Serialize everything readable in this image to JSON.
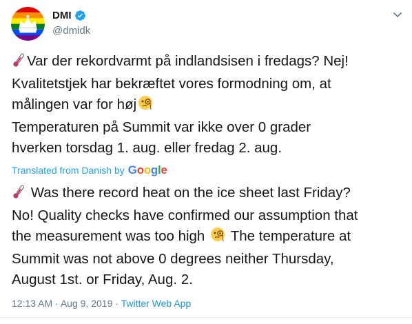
{
  "account": {
    "display_name": "DMI",
    "handle": "@dmidk"
  },
  "icons": {
    "verified": "verified-badge-icon",
    "caret": "chevron-down-icon",
    "thermometer": "thermometer-emoji",
    "monocle": "face-with-monocle-emoji"
  },
  "tweet": {
    "original_lines": [
      "Var der rekordvarmt på indlandsisen i fredags? Nej!",
      "Kvalitetstjek har bekræftet vores formodning om, at",
      "målingen var for høj",
      "Temperaturen på Summit var ikke over 0 grader",
      "hverken torsdag 1. aug. eller fredag 2. aug."
    ],
    "translated_label": "Translated from Danish",
    "by_label": "by",
    "google": [
      "G",
      "o",
      "o",
      "g",
      "l",
      "e"
    ],
    "translated_lines": [
      "Was there record heat on the ice sheet last Friday?",
      "No! Quality checks have confirmed our assumption that",
      "the measurement was too high",
      "The temperature at",
      "Summit was not above 0 degrees neither Thursday,",
      "August 1st. or Friday, Aug. 2."
    ],
    "time": "12:13 AM",
    "separator": "·",
    "date": "Aug 9, 2019",
    "source": "Twitter Web App"
  },
  "colors": {
    "link_blue": "#1da1f2",
    "muted_gray": "#657786",
    "google": [
      "#4285F4",
      "#EA4335",
      "#FBBC05",
      "#4285F4",
      "#34A853",
      "#EA4335"
    ]
  }
}
